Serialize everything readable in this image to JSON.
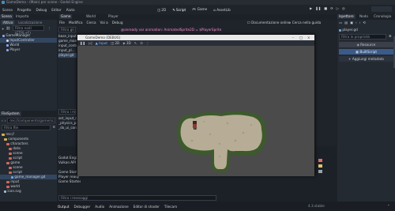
{
  "window": {
    "title": "GameDemo - (Main) per scene - Godot Engine"
  },
  "menu": {
    "items": [
      "Scena",
      "Progetto",
      "Debug",
      "Editor",
      "Aiuto"
    ],
    "workspaces": [
      "2D",
      "Script",
      "Game",
      "AssetLib"
    ]
  },
  "scene_dock": {
    "tabs": [
      "Scena",
      "Importa"
    ],
    "sub_tabs": [
      "Attivo",
      "Localizzazione"
    ],
    "filter_placeholder": "Filtra nodi (CTRL+F)",
    "nodes": [
      {
        "label": "GameManager"
      },
      {
        "label": "InputController"
      },
      {
        "label": "World"
      },
      {
        "label": "Player"
      }
    ]
  },
  "filesystem": {
    "title": "FileSystem",
    "path": "res://components/game/sc...",
    "filter_placeholder": "Filtra file",
    "items": [
      {
        "label": "res://"
      },
      {
        "label": "components"
      },
      {
        "label": "characters"
      },
      {
        "label": "data"
      },
      {
        "label": "scene"
      },
      {
        "label": "script"
      },
      {
        "label": "game"
      },
      {
        "label": "scene"
      },
      {
        "label": "script"
      },
      {
        "label": "game_manager.gd"
      },
      {
        "label": "input"
      },
      {
        "label": "world"
      },
      {
        "label": "icon.svg"
      }
    ]
  },
  "script_editor": {
    "tabs": [
      "Game",
      "World",
      "Player"
    ],
    "menu": [
      "File",
      "Modifica",
      "Cerca",
      "Vai a",
      "Debug"
    ],
    "doc_online": "Documentazione online",
    "search_help": "Cerca nella guida",
    "scripts_filter_placeholder": "Filtra gli script",
    "script_list": [
      "base_input.gd",
      "game_manager.gd",
      "input_controller.gd",
      "input_pl...",
      "player.gd"
    ],
    "code_line": "@onready var animation: AnimatedSprite2D = $PlayerSprite",
    "methods_filter": "Filtra i metodi",
    "methods_list": [
      "set_input_dir...",
      "_physics_pro...",
      "_do_ui_conti..."
    ],
    "output_title": "Output",
    "output_lines": [
      "Godot Engine v4.x",
      "Vulkan API ...",
      "",
      "Game Started",
      "Player ready",
      "Game Started"
    ],
    "message_filter": "Filtra i messaggi"
  },
  "game_window": {
    "title": "GameDemo (DEBUG)",
    "toolbar": [
      "Input",
      "2D",
      "3D"
    ],
    "resolution": "1152x648"
  },
  "inspector": {
    "tabs": [
      "Ispettore",
      "Nodo",
      "Cronologia"
    ],
    "file": "player.gd",
    "filter_placeholder": "Filtra le proprietà",
    "resource_label": "Resource",
    "script_button": "BuiltScript",
    "add_metadata": "Aggiungi metadato"
  },
  "bottom_panel": {
    "tabs": [
      "Output",
      "Debugger",
      "Audio",
      "Animazione",
      "Editor di shader",
      "Tilecam"
    ],
    "version": "4.3.stable"
  },
  "colors": {
    "accent": "#3a5b8a",
    "folder": "#d9b24c",
    "background": "#1d2229"
  }
}
